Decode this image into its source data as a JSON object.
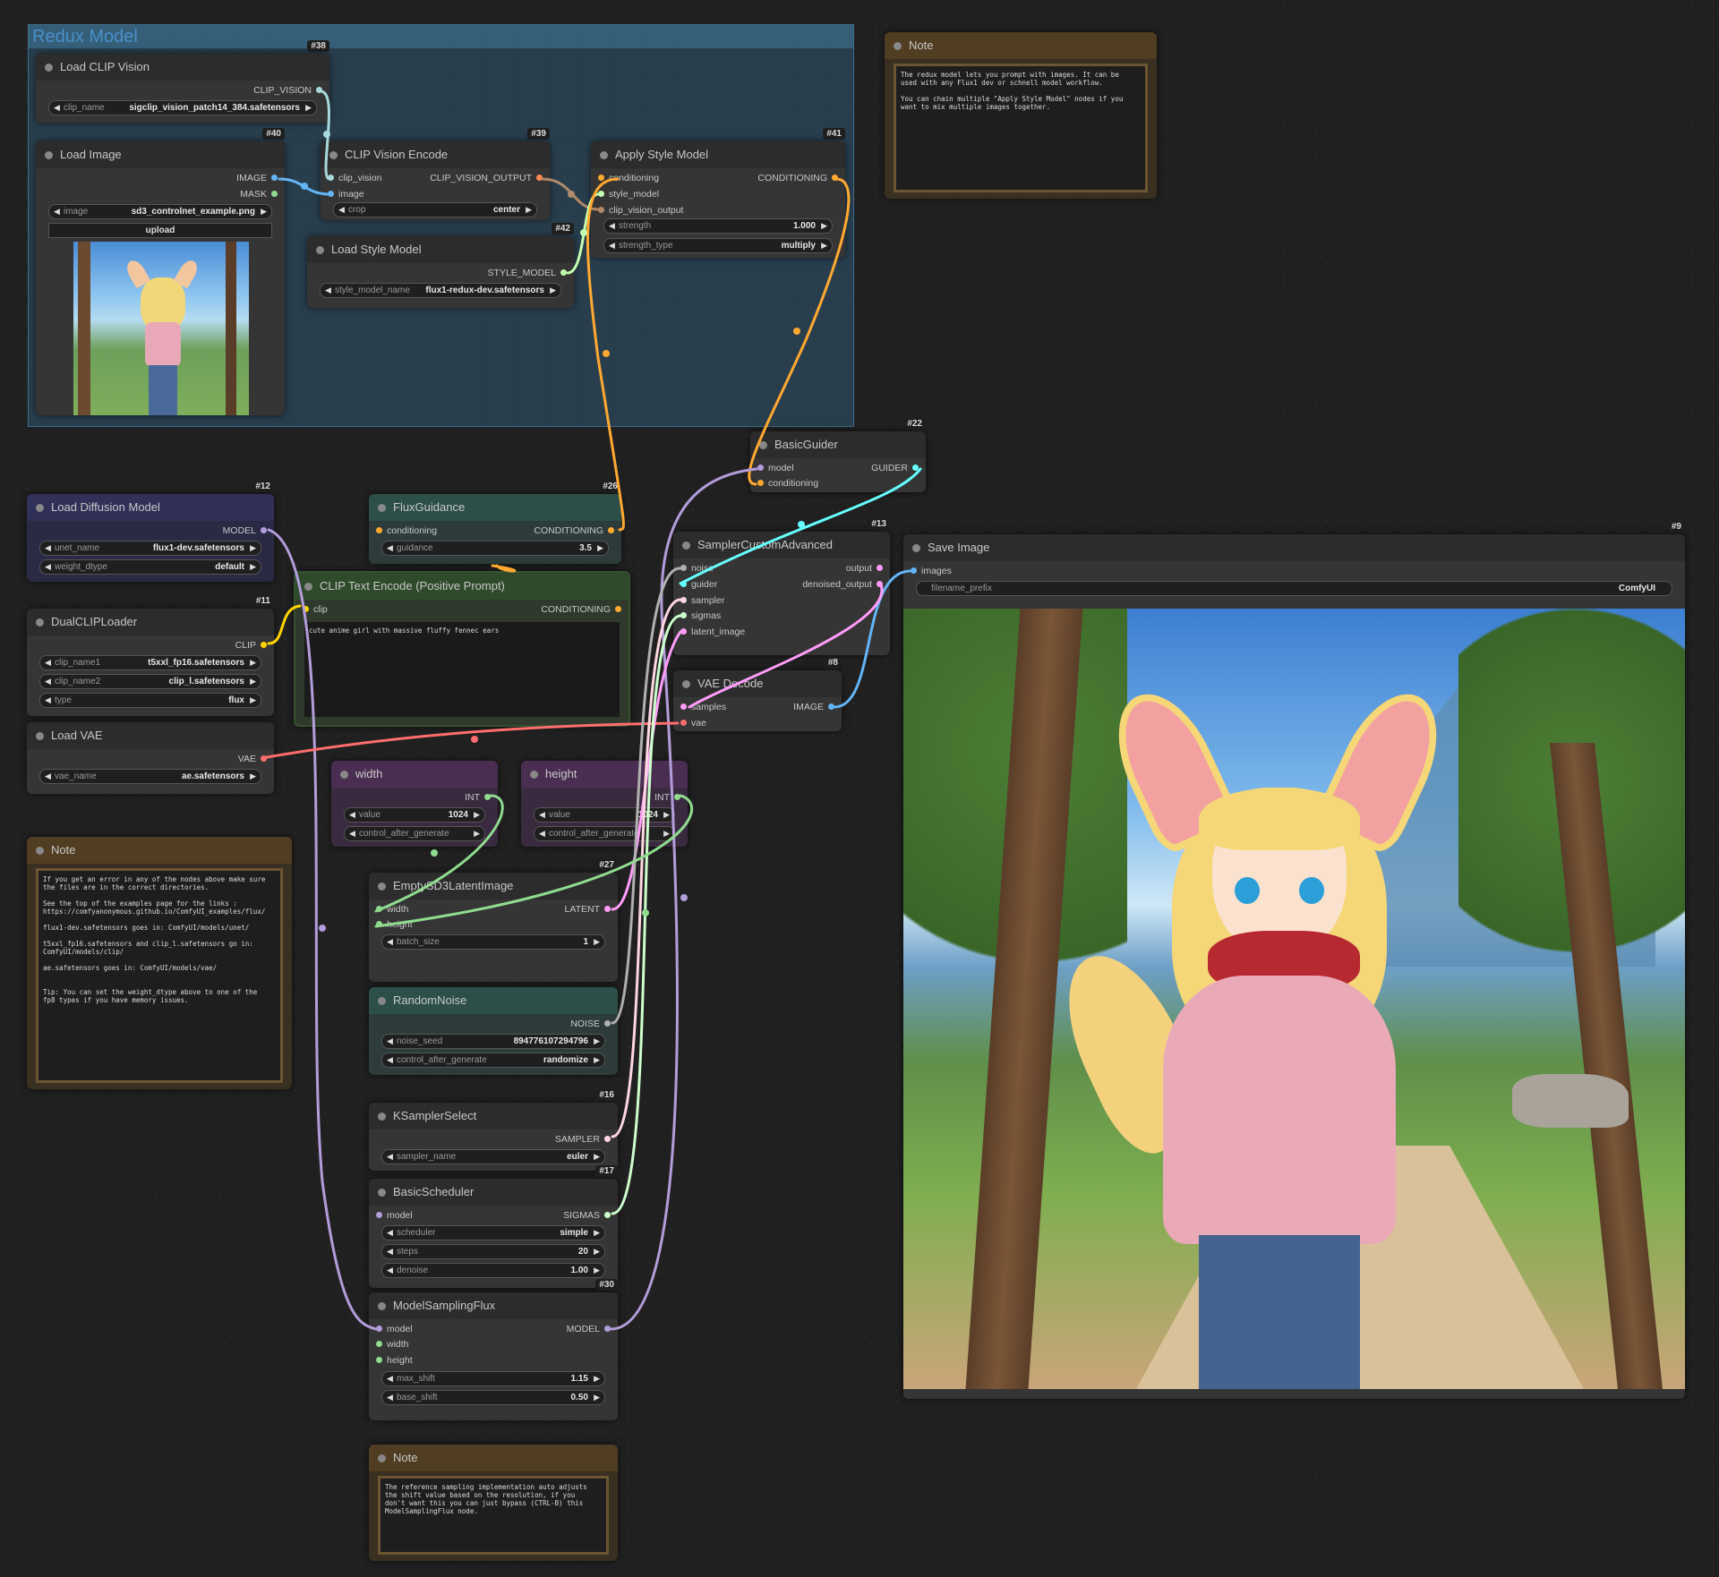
{
  "group": {
    "title": "Redux Model"
  },
  "nodes": {
    "load_clip_vision": {
      "title": "Load CLIP Vision",
      "id": "#38",
      "out": "CLIP_VISION",
      "w_label": "clip_name",
      "w_value": "sigclip_vision_patch14_384.safetensors"
    },
    "load_image": {
      "title": "Load Image",
      "id": "#40",
      "out1": "IMAGE",
      "out2": "MASK",
      "w_label": "image",
      "w_value": "sd3_controlnet_example.png",
      "upload": "upload"
    },
    "clip_vision_encode": {
      "title": "CLIP Vision Encode",
      "id": "#39",
      "in1": "clip_vision",
      "in2": "image",
      "out": "CLIP_VISION_OUTPUT",
      "w_label": "crop",
      "w_value": "center"
    },
    "load_style_model": {
      "title": "Load Style Model",
      "id": "#42",
      "out": "STYLE_MODEL",
      "w_label": "style_model_name",
      "w_value": "flux1-redux-dev.safetensors"
    },
    "apply_style_model": {
      "title": "Apply Style Model",
      "id": "#41",
      "in1": "conditioning",
      "in2": "style_model",
      "in3": "clip_vision_output",
      "out": "CONDITIONING",
      "w1_label": "strength",
      "w1_value": "1.000",
      "w2_label": "strength_type",
      "w2_value": "multiply"
    },
    "note_top": {
      "title": "Note",
      "text": "The redux model lets you prompt with images. It can be\nused with any Flux1 dev or schnell model workflow.\n\nYou can chain multiple \"Apply Style Model\" nodes if you\nwant to mix multiple images together."
    },
    "basic_guider": {
      "title": "BasicGuider",
      "id": "#22",
      "in1": "model",
      "in2": "conditioning",
      "out": "GUIDER"
    },
    "load_diffusion_model": {
      "title": "Load Diffusion Model",
      "id": "#12",
      "out": "MODEL",
      "w1_label": "unet_name",
      "w1_value": "flux1-dev.safetensors",
      "w2_label": "weight_dtype",
      "w2_value": "default"
    },
    "flux_guidance": {
      "title": "FluxGuidance",
      "id": "#26",
      "in1": "conditioning",
      "out": "CONDITIONING",
      "w_label": "guidance",
      "w_value": "3.5"
    },
    "sampler_custom_advanced": {
      "title": "SamplerCustomAdvanced",
      "id": "#13",
      "in1": "noise",
      "in2": "guider",
      "in3": "sampler",
      "in4": "sigmas",
      "in5": "latent_image",
      "out1": "output",
      "out2": "denoised_output"
    },
    "save_image": {
      "title": "Save Image",
      "id": "#9",
      "in1": "images",
      "w_label": "filename_prefix",
      "w_value": "ComfyUI"
    },
    "clip_text_encode": {
      "title": "CLIP Text Encode (Positive Prompt)",
      "in1": "clip",
      "out": "CONDITIONING",
      "text": "cute anime girl with massive fluffy fennec ears"
    },
    "dual_clip_loader": {
      "title": "DualCLIPLoader",
      "id": "#11",
      "out": "CLIP",
      "w1_label": "clip_name1",
      "w1_value": "t5xxl_fp16.safetensors",
      "w2_label": "clip_name2",
      "w2_value": "clip_l.safetensors",
      "w3_label": "type",
      "w3_value": "flux"
    },
    "vae_decode": {
      "title": "VAE Decode",
      "id": "#8",
      "in1": "samples",
      "in2": "vae",
      "out": "IMAGE"
    },
    "load_vae": {
      "title": "Load VAE",
      "out": "VAE",
      "w_label": "vae_name",
      "w_value": "ae.safetensors"
    },
    "width": {
      "title": "width",
      "out": "INT",
      "w1_label": "value",
      "w1_value": "1024",
      "w2_label": "control_after_generate"
    },
    "height": {
      "title": "height",
      "out": "INT",
      "w1_label": "value",
      "w1_value": "1024",
      "w2_label": "control_after_generate"
    },
    "note_left": {
      "title": "Note",
      "text": "If you get an error in any of the nodes above make sure\nthe files are in the correct directories.\n\nSee the top of the examples page for the links :\nhttps://comfyanonymous.github.io/ComfyUI_examples/flux/\n\nflux1-dev.safetensors goes in: ComfyUI/models/unet/\n\nt5xxl_fp16.safetensors and clip_l.safetensors go in:\nComfyUI/models/clip/\n\nae.safetensors goes in: ComfyUI/models/vae/\n\n\nTip: You can set the weight_dtype above to one of the\nfp8 types if you have memory issues."
    },
    "empty_latent": {
      "title": "EmptySD3LatentImage",
      "id": "#27",
      "in1": "width",
      "in2": "height",
      "out": "LATENT",
      "w_label": "batch_size",
      "w_value": "1"
    },
    "random_noise": {
      "title": "RandomNoise",
      "out": "NOISE",
      "w1_label": "noise_seed",
      "w1_value": "894776107294796",
      "w2_label": "control_after_generate",
      "w2_value": "randomize"
    },
    "ksampler_select": {
      "title": "KSamplerSelect",
      "id": "#16",
      "out": "SAMPLER",
      "w_label": "sampler_name",
      "w_value": "euler"
    },
    "basic_scheduler": {
      "title": "BasicScheduler",
      "id": "#17",
      "in1": "model",
      "out": "SIGMAS",
      "w1_label": "scheduler",
      "w1_value": "simple",
      "w2_label": "steps",
      "w2_value": "20",
      "w3_label": "denoise",
      "w3_value": "1.00"
    },
    "model_sampling_flux": {
      "title": "ModelSamplingFlux",
      "id": "#30",
      "in1": "model",
      "in2": "width",
      "in3": "height",
      "out": "MODEL",
      "w1_label": "max_shift",
      "w1_value": "1.15",
      "w2_label": "base_shift",
      "w2_value": "0.50"
    },
    "note_bottom": {
      "title": "Note",
      "text": "The reference sampling implementation auto adjusts\nthe shift value based on the resolution, if you\ndon't want this you can just bypass (CTRL-B) this\nModelSamplingFlux node."
    }
  },
  "colors": {
    "model": "#b39ddb",
    "conditioning": "#ffa931",
    "clip": "#ffd500",
    "vae": "#ff6e6e",
    "image": "#64b5f6",
    "latent": "#ff9cf9",
    "int": "#8fdc8f",
    "guider": "#66ffff",
    "clip_vision": "#a8dadc",
    "style_model": "#c2ffae",
    "noise": "#b0b0b0",
    "sampler": "#ffd7e0",
    "sigmas": "#cdffcd"
  }
}
